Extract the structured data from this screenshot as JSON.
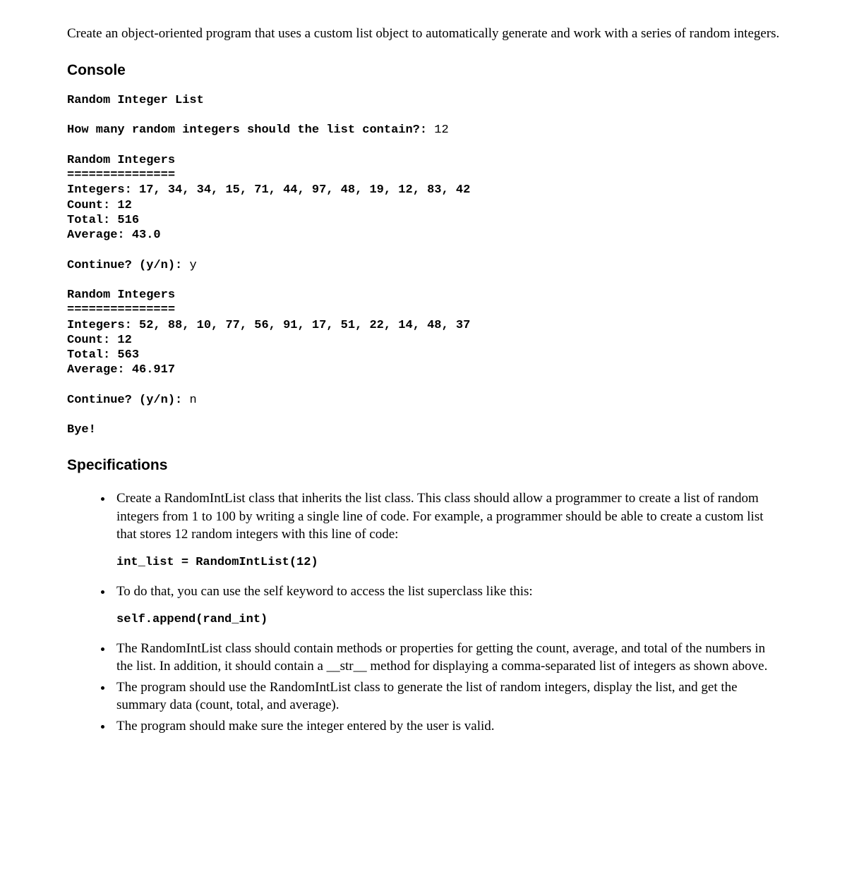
{
  "intro": "Create an object-oriented program that uses a custom list object to automatically generate and work with a series of random integers.",
  "headings": {
    "console": "Console",
    "specifications": "Specifications"
  },
  "console": {
    "title": "Random Integer List",
    "promptCountLabel": "How many random integers should the list contain?:",
    "promptCountValue": "12",
    "sectionHeader": "Random Integers",
    "divider": "===============",
    "labels": {
      "integers": "Integers:",
      "count": "Count:",
      "total": "Total:",
      "average": "Average:",
      "continue": "Continue? (y/n):"
    },
    "run1": {
      "integers": "17, 34, 34, 15, 71, 44, 97, 48, 19, 12, 83, 42",
      "count": "12",
      "total": "516",
      "average": "43.0",
      "continueAnswer": "y"
    },
    "run2": {
      "integers": "52, 88, 10, 77, 56, 91, 17, 51, 22, 14, 48, 37",
      "count": "12",
      "total": "563",
      "average": "46.917",
      "continueAnswer": "n"
    },
    "bye": "Bye!"
  },
  "specs": {
    "item1": "Create a RandomIntList class that inherits the list class. This class should allow a programmer to create a list of random integers from 1 to 100 by writing a single line of code. For example, a programmer should be able to create a custom list that stores 12 random integers with this line of code:",
    "code1": "int_list = RandomIntList(12)",
    "item2": "To do that, you can use the self keyword to access the list superclass like this:",
    "code2": "self.append(rand_int)",
    "item3": "The RandomIntList class should contain methods or properties for getting the count, average, and total of the numbers in the list. In addition, it should contain a __str__ method for displaying a comma-separated list of integers as shown above.",
    "item4": "The program should use the RandomIntList class to generate the list of random integers, display the list, and get the summary data (count, total, and average).",
    "item5": "The program should make sure the integer entered by the user is valid."
  }
}
